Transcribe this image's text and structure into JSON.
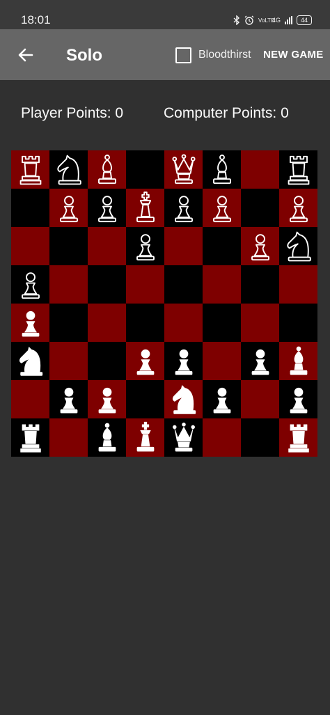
{
  "status_bar": {
    "time": "18:01",
    "icons": [
      "bluetooth-icon",
      "alarm-icon",
      "volte-icon",
      "4g-icon",
      "signal-icon",
      "battery-icon"
    ],
    "network_label": "4G",
    "volte_label": "VoLTE",
    "battery": "44"
  },
  "app_bar": {
    "back_icon": "arrow-left-icon",
    "title": "Solo",
    "bloodthirst_label": "Bloodthirst",
    "bloodthirst_checked": false,
    "new_game_label": "NEW GAME"
  },
  "scores": {
    "player": "Player Points: 0",
    "computer": "Computer Points: 0"
  },
  "colors": {
    "background": "#303030",
    "app_bar": "#666666",
    "dark_square": "#000000",
    "light_square": "#7e0000",
    "opponent_pieces": "outline-white",
    "player_pieces": "solid-white"
  },
  "board": {
    "rows": [
      [
        {
          "p": "rook",
          "s": "o"
        },
        {
          "p": "knight",
          "s": "o"
        },
        {
          "p": "bishop",
          "s": "o"
        },
        null,
        {
          "p": "queen",
          "s": "o"
        },
        {
          "p": "bishop",
          "s": "o"
        },
        null,
        {
          "p": "rook",
          "s": "o"
        }
      ],
      [
        null,
        {
          "p": "pawn",
          "s": "o"
        },
        {
          "p": "pawn",
          "s": "o"
        },
        {
          "p": "king",
          "s": "o"
        },
        {
          "p": "pawn",
          "s": "o"
        },
        {
          "p": "pawn",
          "s": "o"
        },
        null,
        {
          "p": "pawn",
          "s": "o"
        }
      ],
      [
        null,
        null,
        null,
        {
          "p": "pawn",
          "s": "o"
        },
        null,
        null,
        {
          "p": "pawn",
          "s": "o"
        },
        {
          "p": "knight",
          "s": "o"
        }
      ],
      [
        {
          "p": "pawn",
          "s": "o"
        },
        null,
        null,
        null,
        null,
        null,
        null,
        null
      ],
      [
        {
          "p": "pawn",
          "s": "w"
        },
        null,
        null,
        null,
        null,
        null,
        null,
        null
      ],
      [
        {
          "p": "knight",
          "s": "w"
        },
        null,
        null,
        {
          "p": "pawn",
          "s": "w"
        },
        {
          "p": "pawn",
          "s": "w"
        },
        null,
        {
          "p": "pawn",
          "s": "w"
        },
        {
          "p": "bishop",
          "s": "w"
        }
      ],
      [
        null,
        {
          "p": "pawn",
          "s": "w"
        },
        {
          "p": "pawn",
          "s": "w"
        },
        null,
        {
          "p": "knight",
          "s": "w"
        },
        {
          "p": "pawn",
          "s": "w"
        },
        null,
        {
          "p": "pawn",
          "s": "w"
        }
      ],
      [
        {
          "p": "rook",
          "s": "w"
        },
        null,
        {
          "p": "bishop",
          "s": "w"
        },
        {
          "p": "king",
          "s": "w"
        },
        {
          "p": "queen",
          "s": "w"
        },
        null,
        null,
        {
          "p": "rook",
          "s": "w"
        }
      ]
    ]
  }
}
